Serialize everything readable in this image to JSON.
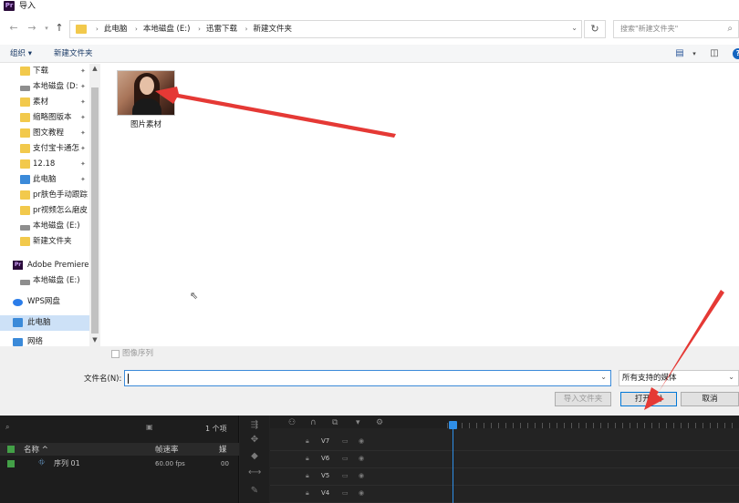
{
  "window": {
    "title": "导入"
  },
  "address": {
    "crumbs": [
      "此电脑",
      "本地磁盘 (E:)",
      "迅雷下载",
      "新建文件夹"
    ],
    "search_placeholder": "搜索\"新建文件夹\""
  },
  "toolbar": {
    "organize_label": "组织 ▾",
    "new_folder_label": "新建文件夹"
  },
  "sidebar": {
    "items": [
      {
        "label": "下载",
        "icon": "folder-icon",
        "pinned": true
      },
      {
        "label": "本地磁盘 (D:",
        "icon": "drive-icon",
        "pinned": true
      },
      {
        "label": "素材",
        "icon": "folder-icon",
        "pinned": true
      },
      {
        "label": "缩略图版本",
        "icon": "folder-icon",
        "pinned": true
      },
      {
        "label": "图文教程",
        "icon": "folder-icon",
        "pinned": true
      },
      {
        "label": "支付宝卡通怎",
        "icon": "folder-icon",
        "pinned": true
      },
      {
        "label": "12.18",
        "icon": "folder-icon",
        "pinned": true
      },
      {
        "label": "此电脑",
        "icon": "pc-icon",
        "pinned": true
      },
      {
        "label": "pr肤色手动跟踪",
        "icon": "folder-icon",
        "pinned": false
      },
      {
        "label": "pr视频怎么磨皮",
        "icon": "folder-icon",
        "pinned": false
      },
      {
        "label": "本地磁盘 (E:)",
        "icon": "drive-icon",
        "pinned": false
      },
      {
        "label": "新建文件夹",
        "icon": "folder-icon",
        "pinned": false
      },
      {
        "label": "Adobe Premiere",
        "icon": "premiere-icon",
        "pinned": false
      },
      {
        "label": "本地磁盘 (E:)",
        "icon": "drive-icon",
        "pinned": false
      },
      {
        "label": "WPS网盘",
        "icon": "cloud-icon",
        "pinned": false
      },
      {
        "label": "此电脑",
        "icon": "pc-icon",
        "pinned": false,
        "selected": true
      },
      {
        "label": "网络",
        "icon": "network-icon",
        "pinned": false
      }
    ]
  },
  "files": [
    {
      "name": "图片素材",
      "type": "image"
    }
  ],
  "dialog": {
    "image_sequence_label": "图像序列",
    "filename_label": "文件名(N):",
    "filename_value": "",
    "filetype_value": "所有支持的媒体",
    "import_folder_label": "导入文件夹",
    "open_label": "打开(O)",
    "cancel_label": "取消"
  },
  "premiere": {
    "item_count": "1 个项",
    "col_name": "名称 ^",
    "col_fps": "帧速率",
    "col_more": "媒",
    "sequence_name": "序列 01",
    "sequence_fps": "60.00 fps",
    "sequence_more": "00",
    "tracks": [
      "V7",
      "V6",
      "V5",
      "V4"
    ]
  },
  "colors": {
    "accent": "#0078d7",
    "folder": "#f2c94c",
    "annotation_arrow": "#e53935",
    "premiere_bg": "#232323",
    "playhead": "#2f8fe8"
  }
}
